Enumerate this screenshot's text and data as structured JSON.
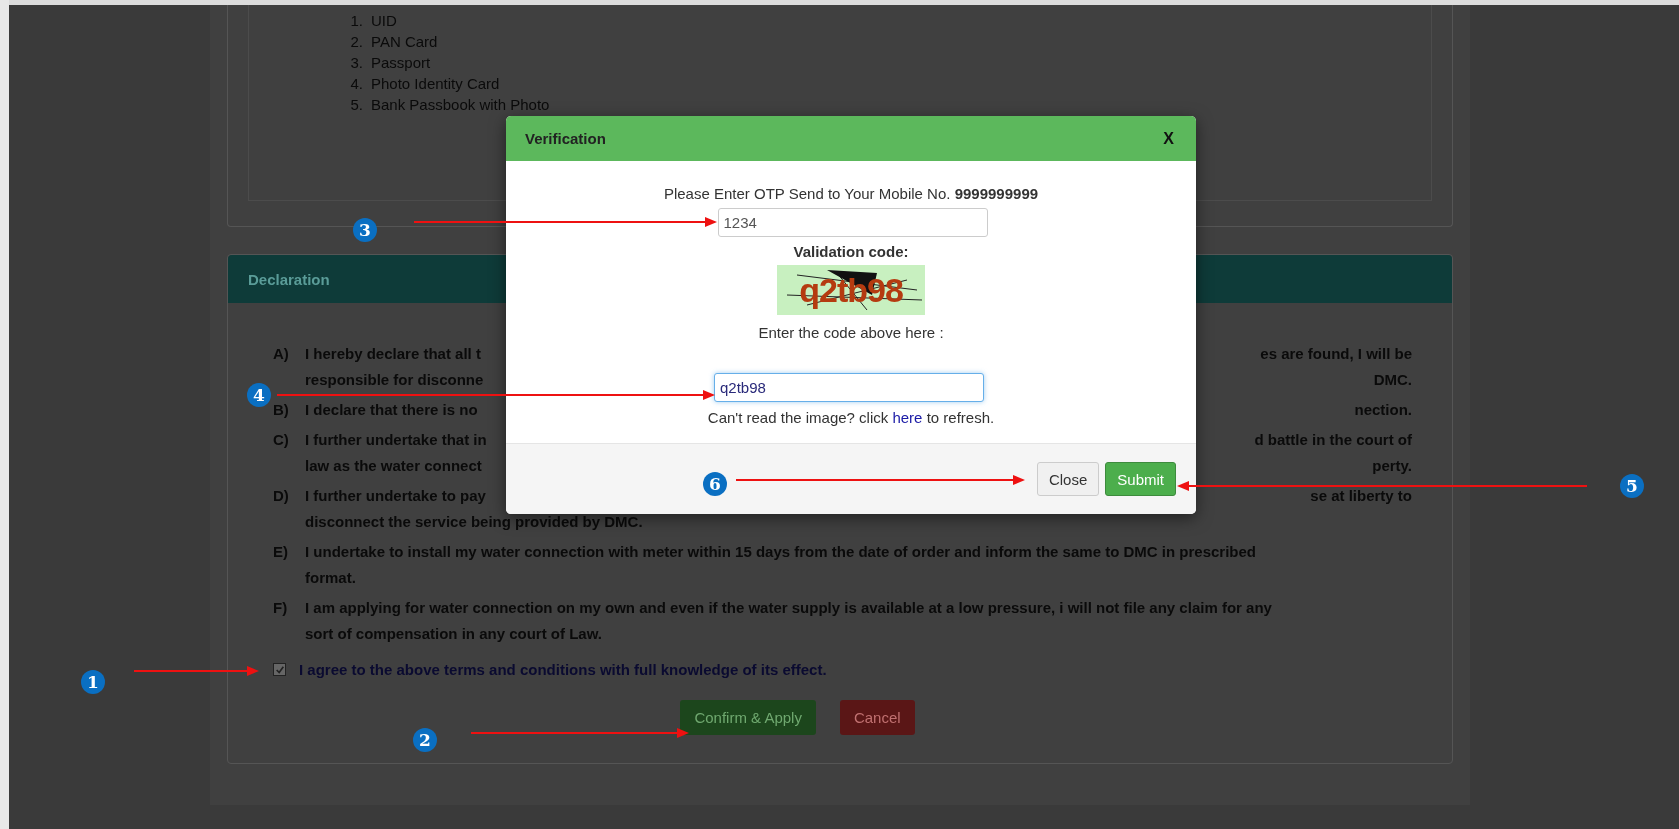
{
  "id_list": [
    {
      "number": "1.",
      "text": "UID"
    },
    {
      "number": "2.",
      "text": "PAN Card"
    },
    {
      "number": "3.",
      "text": "Passport"
    },
    {
      "number": "4.",
      "text": "Photo Identity Card"
    },
    {
      "number": "5.",
      "text": "Bank Passbook with Photo"
    }
  ],
  "declaration": {
    "title": "Declaration",
    "items": [
      {
        "letter": "A)",
        "lines": [
          {
            "left": "I hereby declare that all t",
            "right": "es are found, I will be"
          },
          {
            "left": "responsible for disconne",
            "right": "DMC."
          }
        ]
      },
      {
        "letter": "B)",
        "lines": [
          {
            "left": "I declare that there is no",
            "right": "nection."
          }
        ]
      },
      {
        "letter": "C)",
        "lines": [
          {
            "left": "I further undertake that in",
            "right": "d battle in the court of"
          },
          {
            "left": "law as the water connect",
            "right": "perty."
          }
        ]
      },
      {
        "letter": "D)",
        "lines": [
          {
            "left": "I further undertake to pay",
            "right": "se at liberty to"
          },
          {
            "left": "disconnect the service being provided by DMC."
          }
        ]
      },
      {
        "letter": "E)",
        "lines": [
          {
            "left": "I undertake to install my water connection with meter within 15 days from the date of order and inform the same to DMC in prescribed"
          },
          {
            "left": "format."
          }
        ]
      },
      {
        "letter": "F)",
        "lines": [
          {
            "left": "I am applying for water connection on my own and even if the water supply is available at a low pressure, i will not file any claim for any"
          },
          {
            "left": "sort of compensation in any court of Law."
          }
        ]
      }
    ],
    "agree": {
      "label": "I agree to the above terms and conditions with full knowledge of its effect.",
      "checked": true
    },
    "buttons": [
      {
        "label": "Confirm & Apply",
        "kind": "confirm"
      },
      {
        "label": "Cancel",
        "kind": "cancel"
      }
    ]
  },
  "modal": {
    "title": "Verification",
    "close": "X",
    "prompt": "Please Enter OTP Send to Your Mobile No. **9999999999**",
    "otp_value": "1234",
    "validation_label": "Validation code:",
    "captcha": "q2tb98",
    "code_label": "Enter the code above here :",
    "code_value": "q2tb98",
    "refresh_before": "Can't read the image? click ",
    "refresh_link": "here",
    "refresh_after": " to refresh.",
    "buttons": [
      {
        "label": "Close",
        "kind": "default"
      },
      {
        "label": "Submit",
        "kind": "success"
      }
    ]
  },
  "annotations": [
    {
      "number": "1"
    },
    {
      "number": "2"
    },
    {
      "number": "3"
    },
    {
      "number": "4"
    },
    {
      "number": "5"
    },
    {
      "number": "6"
    }
  ]
}
